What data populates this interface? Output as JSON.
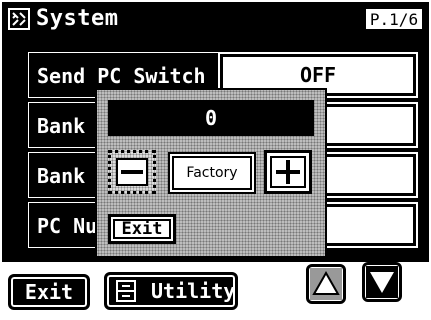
{
  "header": {
    "title": "System",
    "page": "P.1/6",
    "icon": "tools-icon"
  },
  "params": [
    {
      "label": "Send PC Switch",
      "value": "OFF"
    },
    {
      "label": "Bank MSB",
      "value": ""
    },
    {
      "label": "Bank LSB",
      "value": ""
    },
    {
      "label": "PC Number",
      "value": ""
    }
  ],
  "dialog": {
    "value": "0",
    "factory_label": "Factory",
    "exit_label": "Exit"
  },
  "footer": {
    "exit_label": "Exit",
    "utility_label": "Utility"
  },
  "icons": [
    "tools-icon",
    "utility-icon",
    "minus-icon",
    "plus-icon",
    "arrow-up-icon",
    "arrow-down-icon"
  ]
}
